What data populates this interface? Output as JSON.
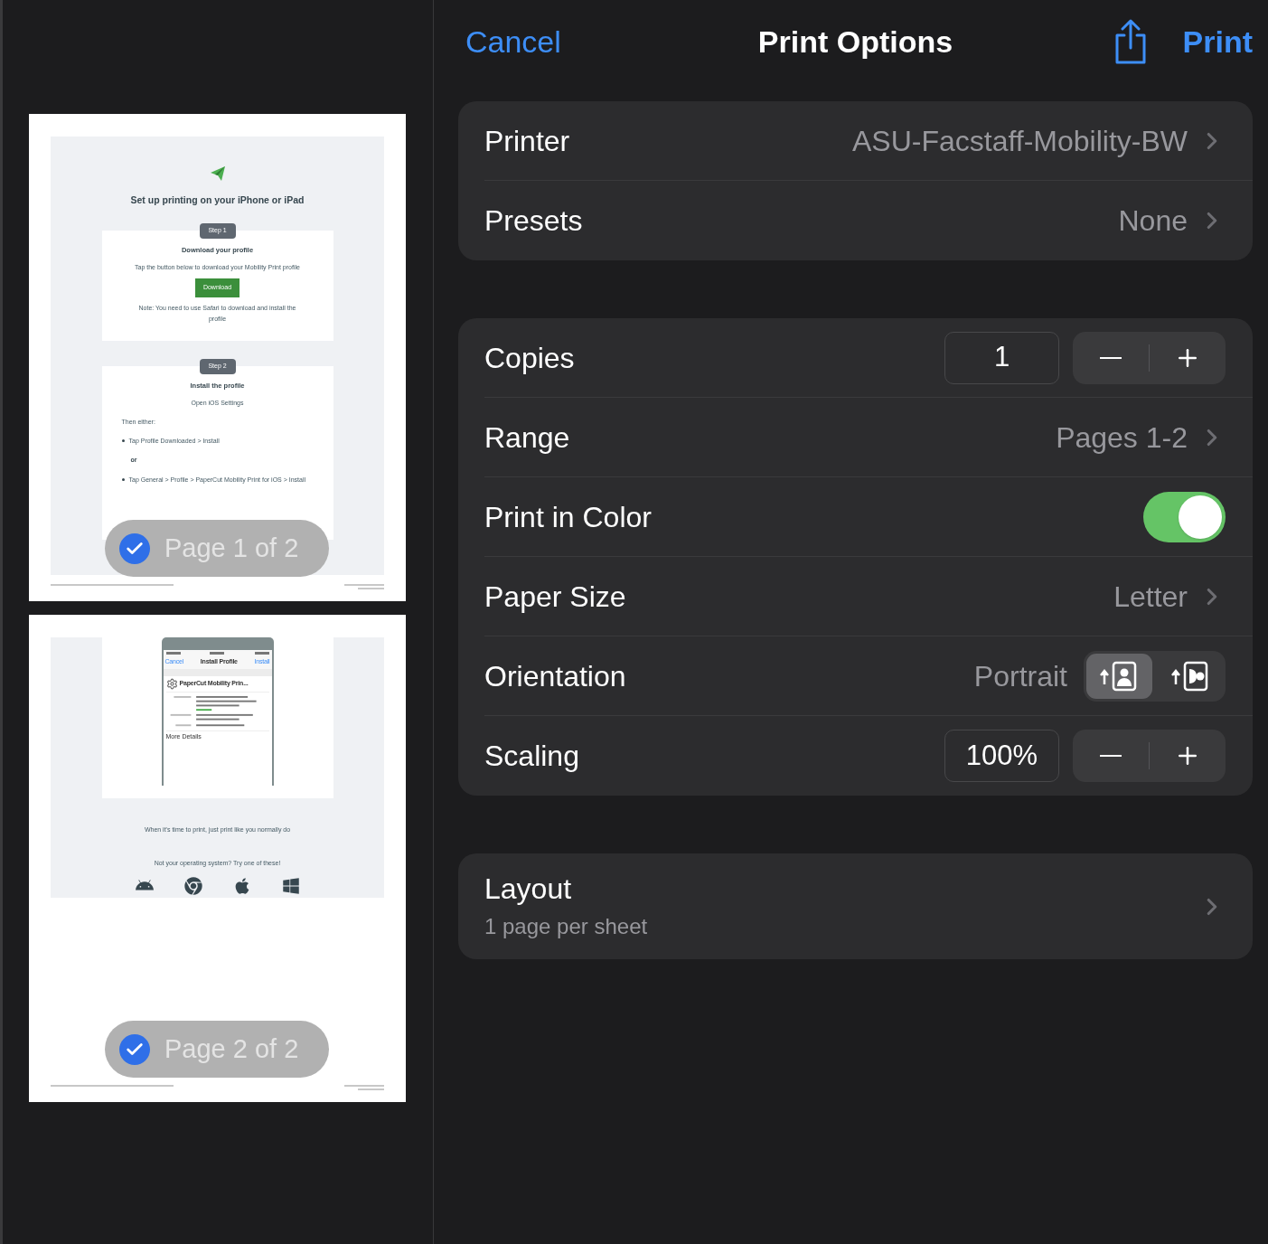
{
  "header": {
    "cancel": "Cancel",
    "title": "Print Options",
    "print": "Print"
  },
  "pages": [
    {
      "label": "Page 1 of 2",
      "selected": true,
      "doc": {
        "kind": "setup",
        "title": "Set up printing on your iPhone or iPad",
        "steps": [
          {
            "badge": "Step 1",
            "heading": "Download your profile",
            "text": "Tap the button below to download your Mobility Print profile",
            "button": "Download",
            "note": "Note: You need to use Safari to download and install the profile"
          },
          {
            "badge": "Step 2",
            "heading": "Install the profile",
            "text": "Open iOS Settings",
            "intro": "Then either:",
            "bullets": [
              "Tap Profile Downloaded > Install",
              "Tap General > Profile > PaperCut Mobility Print for iOS > Install"
            ],
            "separator": "or"
          }
        ]
      }
    },
    {
      "label": "Page 2 of 2",
      "selected": true,
      "doc": {
        "kind": "profile",
        "phone": {
          "cancel": "Cancel",
          "title": "Install Profile",
          "install": "Install",
          "profile": "PaperCut Mobility Prin...",
          "more": "More Details"
        },
        "lines": [
          "When it's time to print, just print like you normally do",
          "Not your operating system? Try one of these!"
        ]
      }
    }
  ],
  "groups": [
    {
      "rows": [
        {
          "kind": "disclosure",
          "label": "Printer",
          "value": "ASU-Facstaff-Mobility-BW"
        },
        {
          "kind": "disclosure",
          "label": "Presets",
          "value": "None"
        }
      ]
    },
    {
      "rows": [
        {
          "kind": "stepper",
          "label": "Copies",
          "value": "1"
        },
        {
          "kind": "disclosure",
          "label": "Range",
          "value": "Pages 1-2"
        },
        {
          "kind": "toggle",
          "label": "Print in Color",
          "on": true
        },
        {
          "kind": "disclosure",
          "label": "Paper Size",
          "value": "Letter"
        },
        {
          "kind": "segmented",
          "label": "Orientation",
          "value": "Portrait",
          "options": [
            {
              "kind": "portrait",
              "selected": true
            },
            {
              "kind": "landscape",
              "selected": false
            }
          ]
        },
        {
          "kind": "stepper",
          "label": "Scaling",
          "value": "100%"
        }
      ]
    },
    {
      "rows": [
        {
          "kind": "subtitle",
          "label": "Layout",
          "value": "1 page per sheet"
        }
      ]
    }
  ]
}
